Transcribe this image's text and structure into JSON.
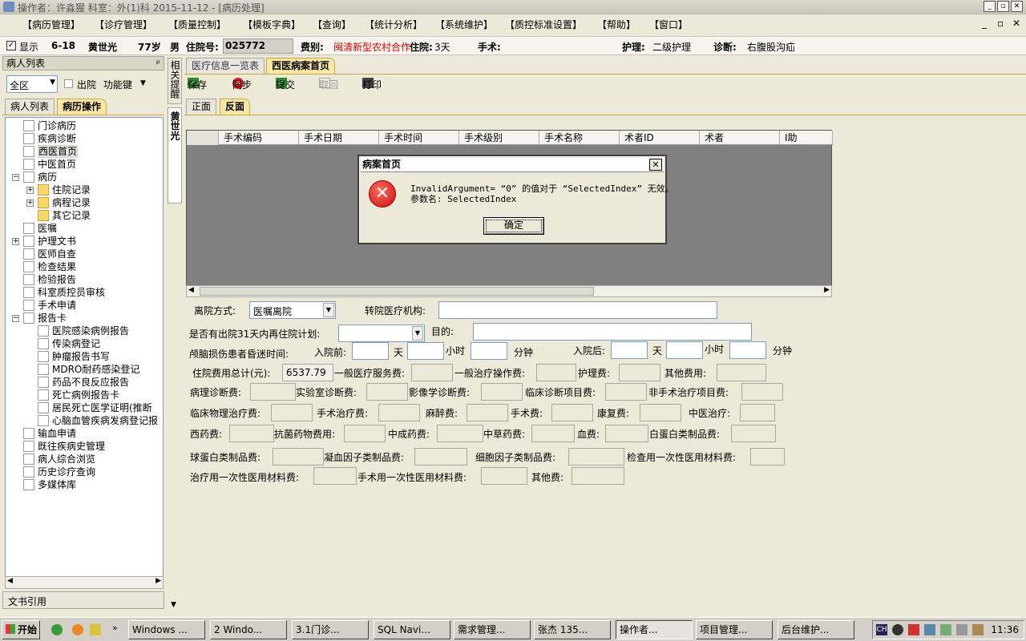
{
  "window": {
    "title": "操作者：许淼猩   科室：外(1)科   2015-11-12 - [病历处理]"
  },
  "menu": [
    "【病历管理】",
    "【诊疗管理】",
    "【质量控制】",
    "【模板字典】",
    "【查询】",
    "【统计分析】",
    "【系统维护】",
    "【质控标准设置】",
    "【帮助】",
    "【窗口】"
  ],
  "patient": {
    "show_label": "显示",
    "bed": "6-18",
    "name": "黄世光",
    "age": "77岁",
    "sex": "男",
    "admission_label": "住院号:",
    "admission_no": "025772",
    "fee_label": "费别:",
    "fee_type": "闽清新型农村合作",
    "stay_label": "住院:",
    "stay": "3天",
    "surgery_label": "手术:",
    "nursing_label": "护理:",
    "nursing": "二级护理",
    "diagnosis_label": "诊断:",
    "diagnosis": "右腹股沟疝"
  },
  "left": {
    "panel_title": "病人列表",
    "pin": "ᵖ",
    "area": "全区",
    "discharged_label": "出院",
    "func_label": "功能键",
    "tabs": [
      "病人列表",
      "病历操作"
    ],
    "tree": [
      {
        "label": "门诊病历",
        "level": 1
      },
      {
        "label": "疾病诊断",
        "level": 1
      },
      {
        "label": "西医首页",
        "level": 1,
        "selected": true
      },
      {
        "label": "中医首页",
        "level": 1
      },
      {
        "label": "病历",
        "level": 1,
        "expander": "−"
      },
      {
        "label": "住院记录",
        "level": 2,
        "expander": "+",
        "folder": true
      },
      {
        "label": "病程记录",
        "level": 2,
        "expander": "+",
        "folder": true
      },
      {
        "label": "其它记录",
        "level": 2,
        "folder": true
      },
      {
        "label": "医嘱",
        "level": 1
      },
      {
        "label": "护理文书",
        "level": 1,
        "expander": "+"
      },
      {
        "label": "医师自查",
        "level": 1
      },
      {
        "label": "检查结果",
        "level": 1
      },
      {
        "label": "检验报告",
        "level": 1
      },
      {
        "label": "科室质控员审核",
        "level": 1
      },
      {
        "label": "手术申请",
        "level": 1
      },
      {
        "label": "报告卡",
        "level": 1,
        "expander": "−"
      },
      {
        "label": "医院感染病例报告",
        "level": 2
      },
      {
        "label": "传染病登记",
        "level": 2
      },
      {
        "label": "肿瘤报告书写",
        "level": 2
      },
      {
        "label": "MDRO耐药感染登记",
        "level": 2
      },
      {
        "label": "药品不良反应报告",
        "level": 2
      },
      {
        "label": "死亡病例报告卡",
        "level": 2
      },
      {
        "label": "居民死亡医学证明(推断",
        "level": 2
      },
      {
        "label": "心脑血管疾病发病登记报",
        "level": 2
      },
      {
        "label": "输血申请",
        "level": 1
      },
      {
        "label": "既往疾病史管理",
        "level": 1
      },
      {
        "label": "病人综合浏览",
        "level": 1
      },
      {
        "label": "历史诊疗查询",
        "level": 1
      },
      {
        "label": "多媒体库",
        "level": 1
      }
    ],
    "footer": "文书引用"
  },
  "sidetabs": {
    "related": "相关提醒",
    "patient": "黄世光"
  },
  "main": {
    "tabs": [
      "医疗信息一览表",
      "西医病案首页"
    ],
    "toolbar": {
      "save": "保存",
      "sync": "同步",
      "submit": "提交",
      "cancel": "取回",
      "print": "打印"
    },
    "subtabs": [
      "正面",
      "反面"
    ],
    "grid_columns": [
      "手术编码",
      "手术日期",
      "手术时间",
      "手术级别",
      "手术名称",
      "术者ID",
      "术者",
      "I助"
    ]
  },
  "form": {
    "discharge_label": "离院方式:",
    "discharge_value": "医嘱离院",
    "transfer_label": "转院医疗机构:",
    "readmit_label": "是否有出院31天内再住院计划:",
    "purpose_label": "目的:",
    "coma_label": "颅脑损伤患者昏迷时间:",
    "before_label": "入院前:",
    "after_label": "入院后:",
    "day": "天",
    "hour": "小时",
    "minute": "分钟",
    "total_label": "住院费用总计(元):",
    "total_value": "6537.79",
    "general_service": "一般医疗服务费:",
    "general_ops": "一般治疗操作费:",
    "nursing_fee": "护理费:",
    "other_fee": "其他费用:",
    "pathology": "病理诊断费:",
    "lab": "实验室诊断费:",
    "imaging": "影像学诊断费:",
    "clinical_diag": "临床诊断项目费:",
    "nonsurgical": "非手术治疗项目费:",
    "physio": "临床物理治疗费:",
    "surgical_treat": "手术治疗费:",
    "anesthesia": "麻醉费:",
    "surgery_fee": "手术费:",
    "rehab": "康复费:",
    "tcm_treat": "中医治疗:",
    "western_drug": "西药费:",
    "antibiotic": "抗菌药物费用:",
    "patent_drug": "中成药费:",
    "herbal": "中草药费:",
    "blood": "血费:",
    "albumin": "白蛋白类制品费:",
    "globulin": "球蛋白类制品费:",
    "coag": "凝血因子类制品费:",
    "cytokine": "细胞因子类制品费:",
    "exam_material": "检查用一次性医用材料费:",
    "treat_material": "治疗用一次性医用材料费:",
    "surgery_material": "手术用一次性医用材料费:",
    "others": "其他费:"
  },
  "dialog": {
    "title": "病案首页",
    "close": "✕",
    "icon": "✕",
    "line1": "InvalidArgument= “0” 的值对于 “SelectedIndex” 无效。",
    "line2": "参数名: SelectedIndex",
    "ok": "确定"
  },
  "taskbar": {
    "start": "开始",
    "items": [
      "Windows ...",
      "2 Windo...",
      "3.1门诊...",
      "SQL Navi...",
      "需求管理...",
      "张杰 135...",
      "操作者...",
      "项目管理...",
      "后台维护..."
    ],
    "clock": "11:36"
  }
}
